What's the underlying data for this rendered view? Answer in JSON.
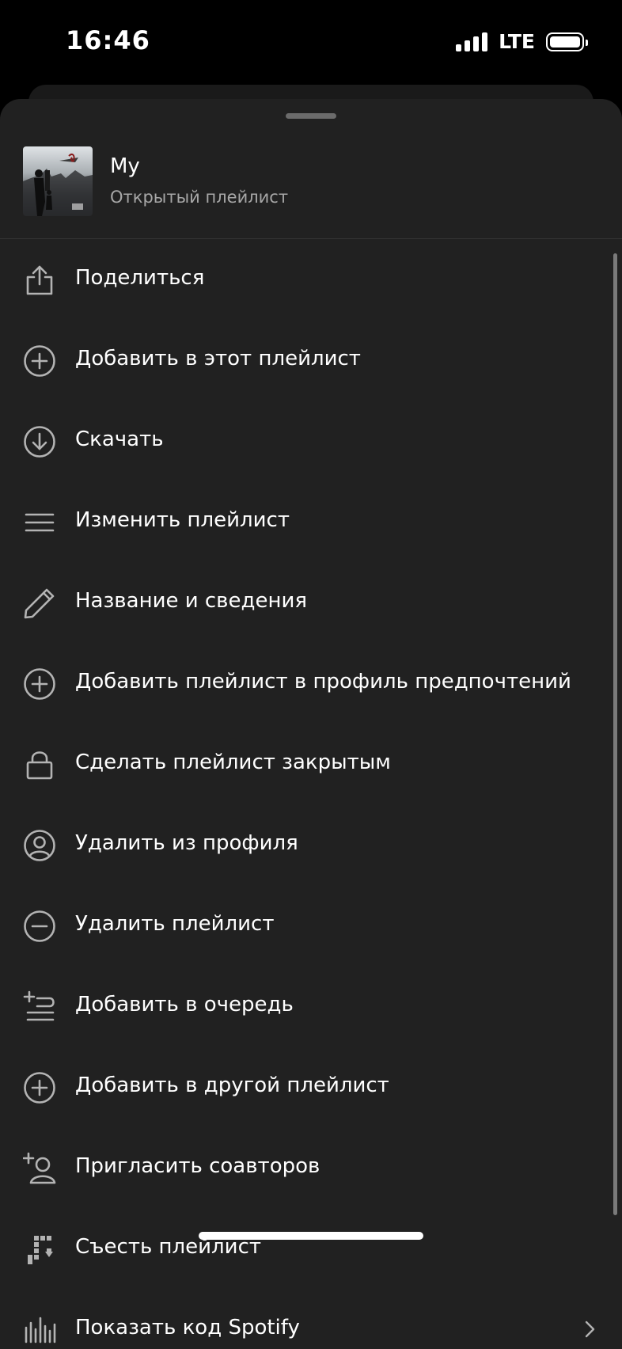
{
  "status_bar": {
    "time": "16:46",
    "network": "LTE"
  },
  "playlist": {
    "title": "My",
    "subtitle": "Открытый плейлист"
  },
  "menu": [
    {
      "label": "Поделиться",
      "icon": "share-icon"
    },
    {
      "label": "Добавить в этот плейлист",
      "icon": "plus-circle-icon"
    },
    {
      "label": "Скачать",
      "icon": "download-icon"
    },
    {
      "label": "Изменить плейлист",
      "icon": "list-icon"
    },
    {
      "label": "Название и сведения",
      "icon": "pencil-icon"
    },
    {
      "label": "Добавить плейлист в профиль предпочтений",
      "icon": "plus-circle-icon"
    },
    {
      "label": "Сделать плейлист закрытым",
      "icon": "lock-icon"
    },
    {
      "label": "Удалить из профиля",
      "icon": "user-circle-icon"
    },
    {
      "label": "Удалить плейлист",
      "icon": "minus-circle-icon"
    },
    {
      "label": "Добавить в очередь",
      "icon": "add-to-queue-icon"
    },
    {
      "label": "Добавить в другой плейлист",
      "icon": "plus-circle-icon"
    },
    {
      "label": "Пригласить соавторов",
      "icon": "add-user-icon"
    },
    {
      "label": "Съесть плейлист",
      "icon": "snake-icon"
    },
    {
      "label": "Показать код Spotify",
      "icon": "spotify-code-icon"
    }
  ],
  "colors": {
    "sheet": "#212121",
    "background": "#000000",
    "secondary_text": "#a7a7a7",
    "icon": "#b3b3b3"
  }
}
